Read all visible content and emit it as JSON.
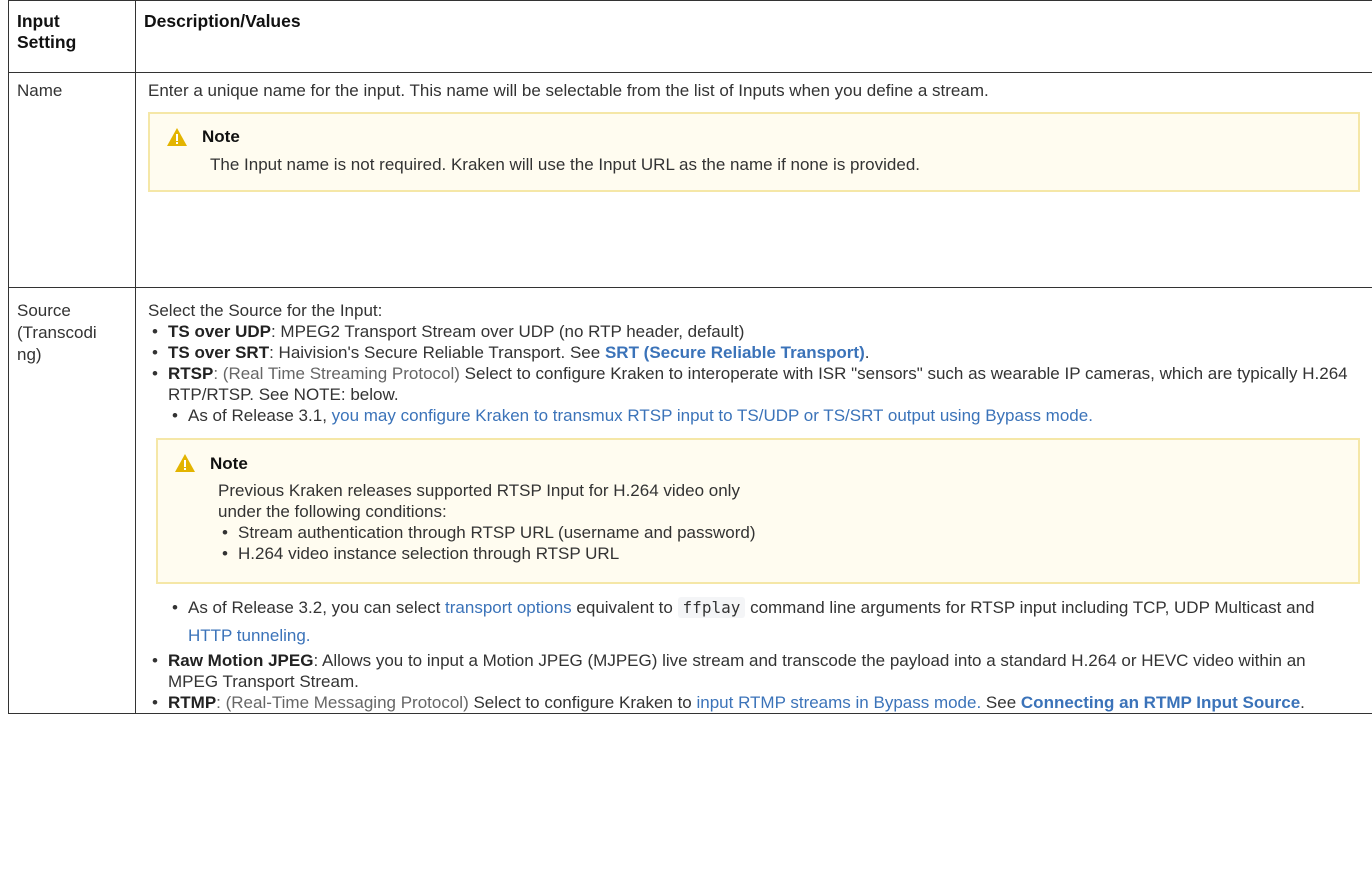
{
  "table": {
    "headers": [
      "Input Setting",
      "Description/Values"
    ],
    "header_col1_line1": "Input",
    "header_col1_line2": "Setting",
    "name_row": {
      "label": "Name",
      "text": "Enter a unique name for the input. This name will be selectable from the list of Inputs when you define a stream.",
      "note_title": "Note",
      "note_text": "The Input name is not required. Kraken will use the Input URL as the name if none is provided."
    },
    "source_row": {
      "label_line1": "Source",
      "label_line2": "(Transcodi",
      "label_line3": "ng)",
      "intro": "Select the Source for the Input:",
      "ts_udp_label": "TS over UDP",
      "ts_udp_text": ": MPEG2 Transport Stream over UDP (no RTP header, default)",
      "ts_srt_label": "TS over SRT",
      "ts_srt_text": ": Haivision's Secure Reliable Transport. See ",
      "ts_srt_link": "SRT (Secure Reliable Transport)",
      "ts_srt_end": ".",
      "rtsp_label": "RTSP",
      "rtsp_paren": ": (Real Time Streaming Protocol)",
      "rtsp_text": " Select to configure Kraken to interoperate with ISR \"sensors\" such as wearable IP cameras, which are typically H.264 RTP/RTSP. See NOTE: below.",
      "rtsp_sub1_pre": "As of Release 3.1, ",
      "rtsp_sub1_link": "you may configure Kraken to transmux RTSP input to TS/UDP or TS/SRT output using Bypass mode.",
      "note2_title": "Note",
      "note2_text": "Previous Kraken releases supported RTSP Input for H.264 video only under the following conditions:",
      "note2_items": [
        "Stream authentication through RTSP URL (username and password)",
        "H.264 video instance selection through RTSP URL"
      ],
      "rtsp_sub2_pre": "As of Release 3.2, you can select ",
      "rtsp_sub2_link1": "transport options",
      "rtsp_sub2_mid": " equivalent to ",
      "rtsp_sub2_code": "ffplay",
      "rtsp_sub2_post": " command line arguments for RTSP input including TCP, UDP Multicast and ",
      "rtsp_sub2_link2": "HTTP tunneling.",
      "mjpeg_label": "Raw Motion JPEG",
      "mjpeg_text": ": Allows you to input a Motion JPEG (MJPEG) live stream and transcode the payload into a standard H.264 or HEVC video within an MPEG Transport Stream.",
      "rtmp_label": "RTMP",
      "rtmp_paren": ": (Real-Time Messaging Protocol)",
      "rtmp_text": " Select to configure Kraken to ",
      "rtmp_link1": "input RTMP streams in Bypass mode.",
      "rtmp_see": " See ",
      "rtmp_link2": "Connecting an RTMP Input Source",
      "rtmp_end": "."
    }
  },
  "colors": {
    "link": "#3b73b9",
    "note_bg": "#fffcf0",
    "note_border": "#f5e7a7",
    "warn_icon": "#e3b400"
  }
}
